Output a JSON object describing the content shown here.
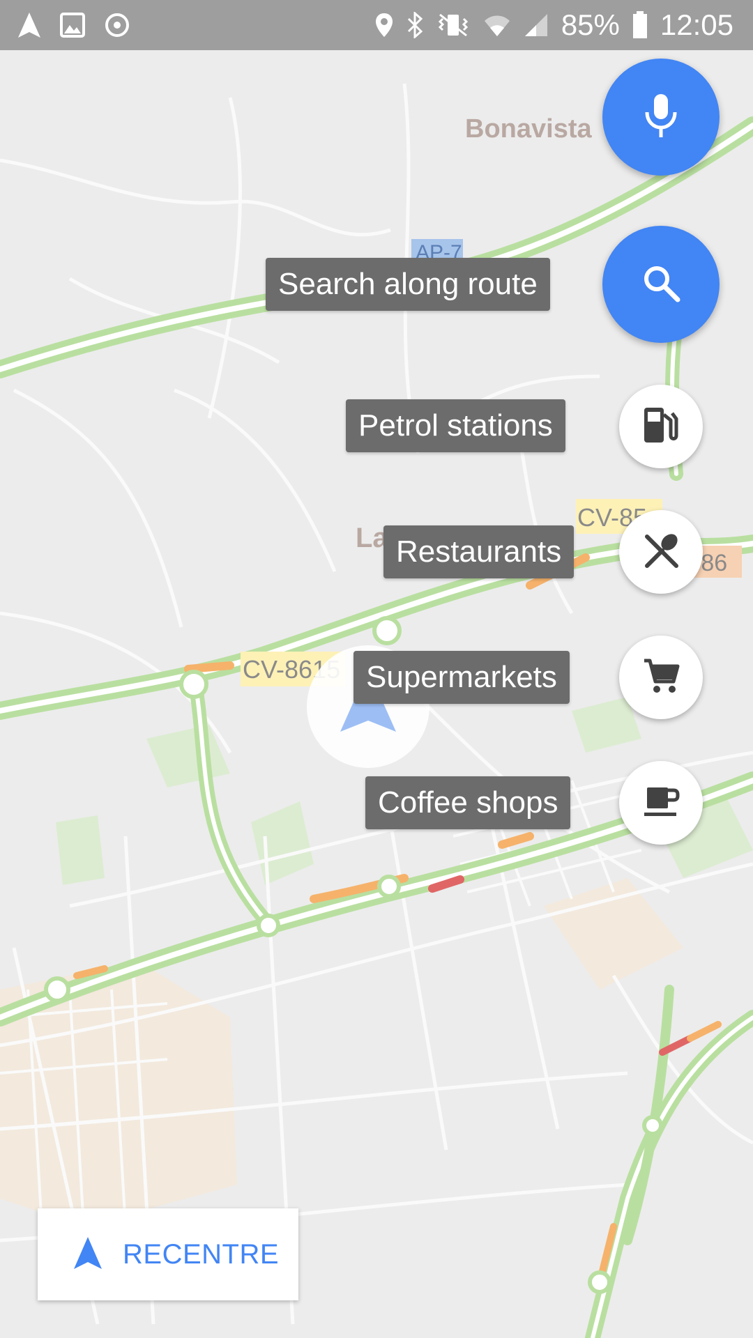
{
  "status_bar": {
    "battery": "85%",
    "time": "12:05",
    "icons": [
      "navigation-icon",
      "image-icon",
      "sync-icon",
      "location-pin-icon",
      "bluetooth-icon",
      "vibrate-mute-icon",
      "wifi-icon",
      "signal-icon",
      "battery-icon"
    ]
  },
  "map": {
    "labels": {
      "place_bonavista": "Bonavista",
      "place_partial": "La",
      "road_ap7": "AP-7",
      "road_cv8615": "CV-8615",
      "road_cv85": "CV-85",
      "road_86": "-86"
    }
  },
  "fabs": {
    "voice_icon": "microphone-icon",
    "search_icon": "search-icon",
    "search_label": "Search along route"
  },
  "categories": [
    {
      "label": "Petrol stations",
      "icon": "fuel-pump-icon"
    },
    {
      "label": "Restaurants",
      "icon": "fork-spoon-icon"
    },
    {
      "label": "Supermarkets",
      "icon": "shopping-cart-icon"
    },
    {
      "label": "Coffee shops",
      "icon": "coffee-cup-icon"
    }
  ],
  "recentre": {
    "label": "RECENTRE",
    "icon": "navigation-arrow-icon"
  },
  "colors": {
    "accent_blue": "#4285f4",
    "chip_bg": "#6c6c6c",
    "road_green": "#b9dfa0",
    "traffic_orange": "#f6b26b",
    "traffic_red": "#e06666"
  }
}
